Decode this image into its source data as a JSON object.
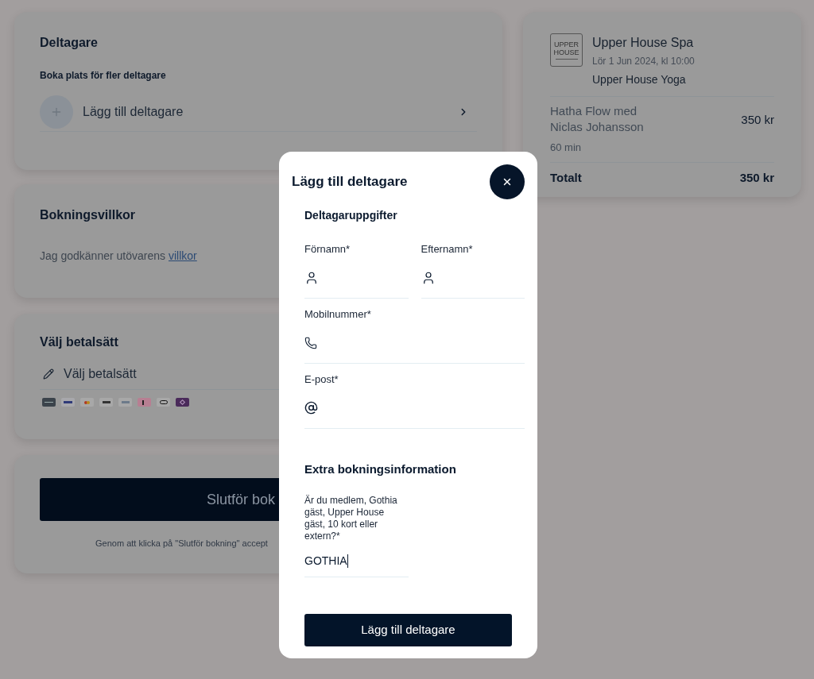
{
  "participants_card": {
    "title": "Deltagare",
    "subtitle": "Boka plats för fler deltagare",
    "add_label": "Lägg till deltagare"
  },
  "terms_card": {
    "title": "Bokningsvillkor",
    "text": "Jag godkänner utövarens",
    "link": "villkor"
  },
  "payment_card": {
    "title": "Välj betalsätt",
    "selector": "Välj betalsätt",
    "methods": [
      {
        "kind": "card"
      },
      {
        "kind": "visa"
      },
      {
        "kind": "mastercard"
      },
      {
        "kind": "applepay"
      },
      {
        "kind": "googlepay"
      },
      {
        "kind": "klarna"
      },
      {
        "kind": "ring"
      },
      {
        "kind": "swish"
      }
    ]
  },
  "checkout_card": {
    "button": "Slutför bok",
    "note": "Genom att klicka på \"Slutför bokning\" accept"
  },
  "summary": {
    "logo_lines": [
      "UPPER",
      "HOUSE"
    ],
    "venue": "Upper House Spa",
    "date": "Lör 1 Jun 2024, kl 10:00",
    "category": "Upper House Yoga",
    "item": {
      "name": "Hatha Flow med Niclas Johansson",
      "price": "350 kr",
      "duration": "60 min"
    },
    "total_label": "Totalt",
    "total": "350 kr"
  },
  "modal": {
    "title": "Lägg till deltagare",
    "section": "Deltagaruppgifter",
    "fields": [
      {
        "label": "Förnamn*",
        "kind": "person"
      },
      {
        "label": "Efternamn*",
        "kind": "person"
      },
      {
        "label": "Mobilnummer*",
        "kind": "phone"
      },
      {
        "label": "E-post*",
        "kind": "email"
      }
    ],
    "extra_title": "Extra bokningsinformation",
    "question": {
      "label": "Är du medlem, Gothia gäst, Upper House gäst, 10 kort eller extern?*",
      "value": "GOTHIA",
      "focused": true
    },
    "submit": "Lägg till deltagare"
  }
}
